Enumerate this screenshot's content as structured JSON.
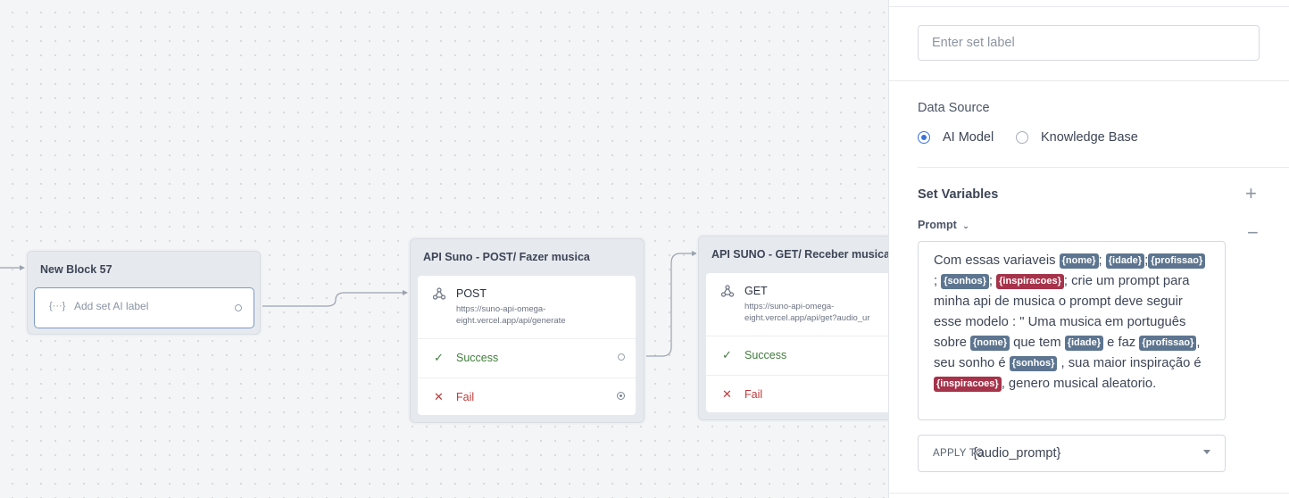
{
  "canvas": {
    "block_57": {
      "title": "New Block 57",
      "set_ai": {
        "icon": "set-ai-icon",
        "glyph": "{···}",
        "placeholder": "Add set AI label"
      }
    },
    "block_post": {
      "title": "API Suno - POST/ Fazer musica",
      "method": "POST",
      "url": "https://suno-api-omega-eight.vercel.app/api/generate",
      "success_label": "Success",
      "fail_label": "Fail"
    },
    "block_get": {
      "title": "API SUNO - GET/ Receber musica",
      "method": "GET",
      "url": "https://suno-api-omega-eight.vercel.app/api/get?audio_ur",
      "success_label": "Success",
      "fail_label": "Fail"
    }
  },
  "panel": {
    "set_label_placeholder": "Enter set label",
    "data_source": {
      "title": "Data Source",
      "options": [
        {
          "label": "AI Model",
          "selected": true
        },
        {
          "label": "Knowledge Base",
          "selected": false
        }
      ]
    },
    "set_variables": {
      "title": "Set Variables",
      "add_icon": "plus-icon",
      "remove_icon": "minus-icon",
      "prompt_label": "Prompt",
      "prompt_parts": [
        "Com essas variaveis ",
        "{nome}",
        "; ",
        "{idade}",
        ";",
        "{profissao}",
        " ; ",
        "{sonhos}",
        "; ",
        "{inspiracoes}",
        "; crie um prompt para minha api de musica o prompt deve seguir esse modelo : \" Uma musica em português sobre ",
        "{nome}",
        " que tem ",
        "{idade}",
        " e faz ",
        "{profissao}",
        ", seu sonho é ",
        "{sonhos}",
        " , sua maior inspiração é ",
        "{inspiracoes}",
        ", genero musical aleatorio."
      ],
      "apply_to_label": "APPLY TO",
      "apply_to_value": "{audio_prompt}"
    },
    "colors": {
      "accent": "#3c73d6",
      "tag_blue": "#5d7590",
      "tag_red": "#a6334a",
      "success": "#3f7d3a",
      "fail": "#bf3b3b"
    }
  }
}
